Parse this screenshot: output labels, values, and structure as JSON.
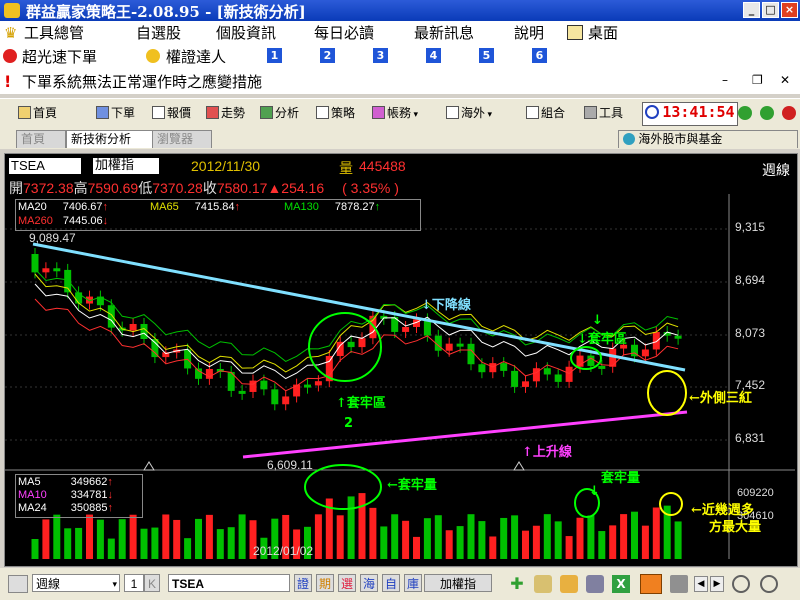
{
  "window": {
    "title": "群益贏家策略王-2.08.95 - [新技術分析]"
  },
  "menu": {
    "items": [
      "工具總管",
      "自選股",
      "個股資訊",
      "每日必讀",
      "最新訊息",
      "說明",
      "桌面"
    ],
    "row2": [
      "超光速下單",
      "權證達人"
    ],
    "numbers": [
      "1",
      "2",
      "3",
      "4",
      "5",
      "6"
    ],
    "notice": "下單系統無法正常運作時之應變措施"
  },
  "toolbar": {
    "items": [
      "首頁",
      "下單",
      "報價",
      "走勢",
      "分析",
      "策略",
      "帳務",
      "海外",
      "組合",
      "工具"
    ],
    "clock": "13:41:54"
  },
  "tabs": {
    "items": [
      "首頁",
      "新技術分析",
      "瀏覽器"
    ],
    "right": "海外股市與基金"
  },
  "chart": {
    "symbol": "TSEA",
    "name": "加權指",
    "date": "2012/11/30",
    "vol_label": "量",
    "volume": "445488",
    "period": "週線",
    "open_label": "開",
    "open": "7372.38",
    "high_label": "高",
    "high": "7590.69",
    "low_label": "低",
    "low": "7370.28",
    "close_label": "收",
    "close": "7580.17",
    "change": "▲254.16",
    "pct": "( 3.35% )",
    "ma": [
      {
        "name": "MA20",
        "value": "7406.67",
        "arrow": "↑"
      },
      {
        "name": "MA65",
        "value": "7415.84",
        "arrow": "↑"
      },
      {
        "name": "MA130",
        "value": "7878.27",
        "arrow": "↑"
      },
      {
        "name": "MA260",
        "value": "7445.06",
        "arrow": "↓"
      }
    ],
    "y_ticks": [
      "9,315",
      "8,694",
      "8,073",
      "7,452",
      "6,831"
    ],
    "max_label": "9,089.47",
    "min_label": "6,609.11",
    "vol_ticks": [
      "609220",
      "304610"
    ],
    "vol_ma": [
      {
        "name": "MA5",
        "value": "349662",
        "arrow": "↑"
      },
      {
        "name": "MA10",
        "value": "334781",
        "arrow": "↓"
      },
      {
        "name": "MA24",
        "value": "350885",
        "arrow": "↑"
      }
    ],
    "x_label": "2012/01/02",
    "annotations": {
      "down": "↓下降線",
      "cover_top": "↓",
      "cover_top2": "↓套牢區",
      "cover_mid": "↑套牢區",
      "num2": "2",
      "up": "↑上升線",
      "outer": "←外側三紅",
      "vol_cover": "←套牢量",
      "vol_cover2": "↓",
      "vol_cover3": "套牢量",
      "vol_recent1": "←近幾週多",
      "vol_recent2": "方最大量"
    }
  },
  "bottom": {
    "period": "週線",
    "num": "1",
    "symbol": "TSEA",
    "btns": [
      "證",
      "期",
      "選",
      "海",
      "自",
      "庫"
    ],
    "name": "加權指"
  },
  "colors": {
    "up": "#ff2020",
    "down": "#00c000",
    "bg": "#000000",
    "grid": "#303030"
  }
}
